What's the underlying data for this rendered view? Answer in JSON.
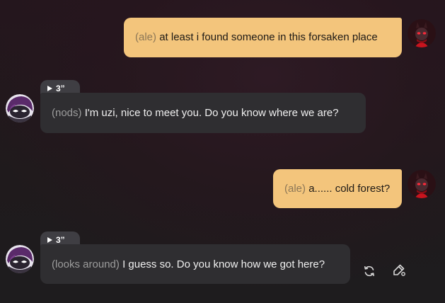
{
  "messages": [
    {
      "role": "user",
      "action": "(ale)",
      "text": "at least i found someone in this forsaken place"
    },
    {
      "role": "bot",
      "voice_duration": "3”",
      "action": "(nods)",
      "text": "I'm uzi, nice to meet you. Do you know where we are?"
    },
    {
      "role": "user",
      "action": "(ale)",
      "text": "a...... cold forest?"
    },
    {
      "role": "bot",
      "voice_duration": "3”",
      "action": "(looks around)",
      "text": "I guess so. Do you know how we got here?"
    }
  ],
  "icons": {
    "voice": "play-icon",
    "regenerate": "refresh-icon",
    "edit": "edit-icon"
  },
  "colors": {
    "user_bubble": "#f3c57c",
    "bot_bubble": "#2f2e31",
    "voice_chip": "#3f3e43"
  }
}
